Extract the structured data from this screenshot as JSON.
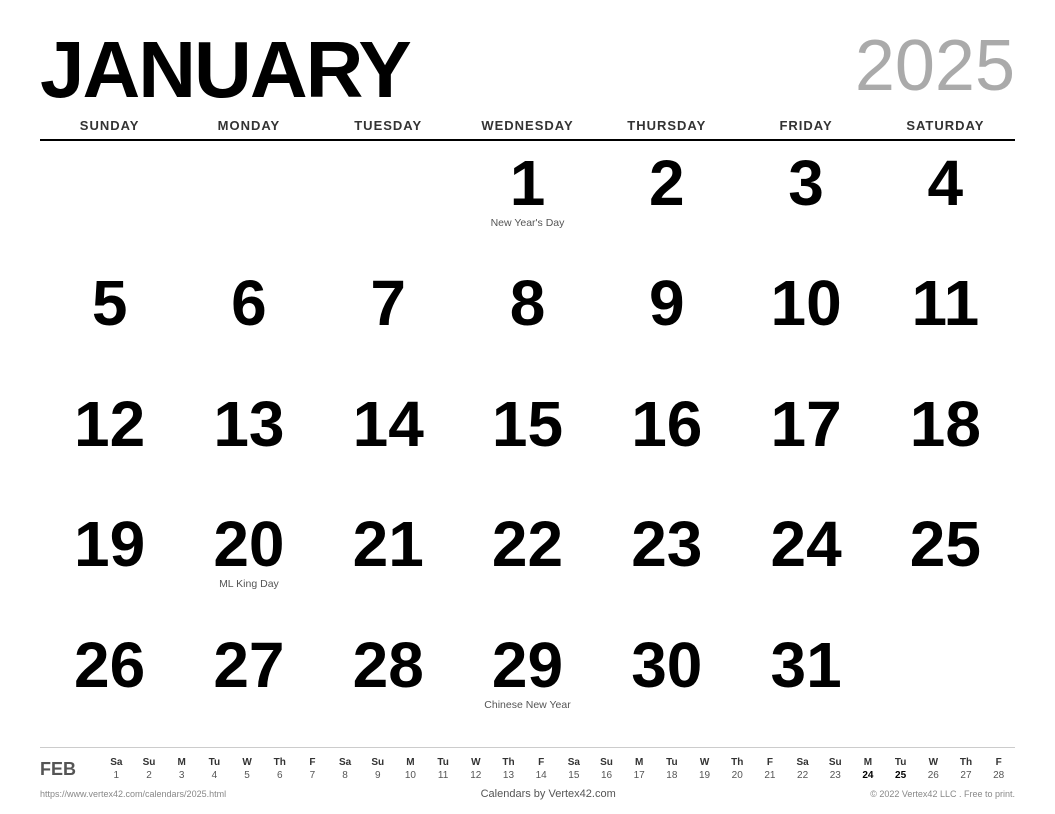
{
  "header": {
    "month": "JANUARY",
    "year": "2025"
  },
  "day_names": [
    "SUNDAY",
    "MONDAY",
    "TUESDAY",
    "WEDNESDAY",
    "THURSDAY",
    "FRIDAY",
    "SATURDAY"
  ],
  "weeks": [
    [
      {
        "date": "",
        "holiday": ""
      },
      {
        "date": "",
        "holiday": ""
      },
      {
        "date": "",
        "holiday": ""
      },
      {
        "date": "1",
        "holiday": "New Year's Day"
      },
      {
        "date": "2",
        "holiday": ""
      },
      {
        "date": "3",
        "holiday": ""
      },
      {
        "date": "4",
        "holiday": ""
      }
    ],
    [
      {
        "date": "5",
        "holiday": ""
      },
      {
        "date": "6",
        "holiday": ""
      },
      {
        "date": "7",
        "holiday": ""
      },
      {
        "date": "8",
        "holiday": ""
      },
      {
        "date": "9",
        "holiday": ""
      },
      {
        "date": "10",
        "holiday": ""
      },
      {
        "date": "11",
        "holiday": ""
      }
    ],
    [
      {
        "date": "12",
        "holiday": ""
      },
      {
        "date": "13",
        "holiday": ""
      },
      {
        "date": "14",
        "holiday": ""
      },
      {
        "date": "15",
        "holiday": ""
      },
      {
        "date": "16",
        "holiday": ""
      },
      {
        "date": "17",
        "holiday": ""
      },
      {
        "date": "18",
        "holiday": ""
      }
    ],
    [
      {
        "date": "19",
        "holiday": ""
      },
      {
        "date": "20",
        "holiday": "ML King Day"
      },
      {
        "date": "21",
        "holiday": ""
      },
      {
        "date": "22",
        "holiday": ""
      },
      {
        "date": "23",
        "holiday": ""
      },
      {
        "date": "24",
        "holiday": ""
      },
      {
        "date": "25",
        "holiday": ""
      }
    ],
    [
      {
        "date": "26",
        "holiday": ""
      },
      {
        "date": "27",
        "holiday": ""
      },
      {
        "date": "28",
        "holiday": ""
      },
      {
        "date": "29",
        "holiday": "Chinese New Year"
      },
      {
        "date": "30",
        "holiday": ""
      },
      {
        "date": "31",
        "holiday": ""
      },
      {
        "date": "",
        "holiday": ""
      }
    ]
  ],
  "mini_calendar": {
    "month_label": "FEB",
    "headers": [
      "Sa",
      "Su",
      "M",
      "Tu",
      "W",
      "Th",
      "F",
      "Sa",
      "Su",
      "M",
      "Tu",
      "W",
      "Th",
      "F",
      "Sa",
      "Su",
      "M",
      "Tu",
      "W",
      "Th",
      "F",
      "Sa",
      "Su",
      "M",
      "Tu",
      "W",
      "Th",
      "F"
    ],
    "dates": [
      "1",
      "2",
      "3",
      "4",
      "5",
      "6",
      "7",
      "8",
      "9",
      "10",
      "11",
      "12",
      "13",
      "14",
      "15",
      "16",
      "17",
      "18",
      "19",
      "20",
      "21",
      "22",
      "23",
      "24",
      "25",
      "26",
      "27",
      "28"
    ],
    "bold_dates": [
      "24",
      "25"
    ]
  },
  "footer": {
    "left": "https://www.vertex42.com/calendars/2025.html",
    "center": "Calendars by Vertex42.com",
    "right": "© 2022 Vertex42 LLC . Free to print."
  }
}
